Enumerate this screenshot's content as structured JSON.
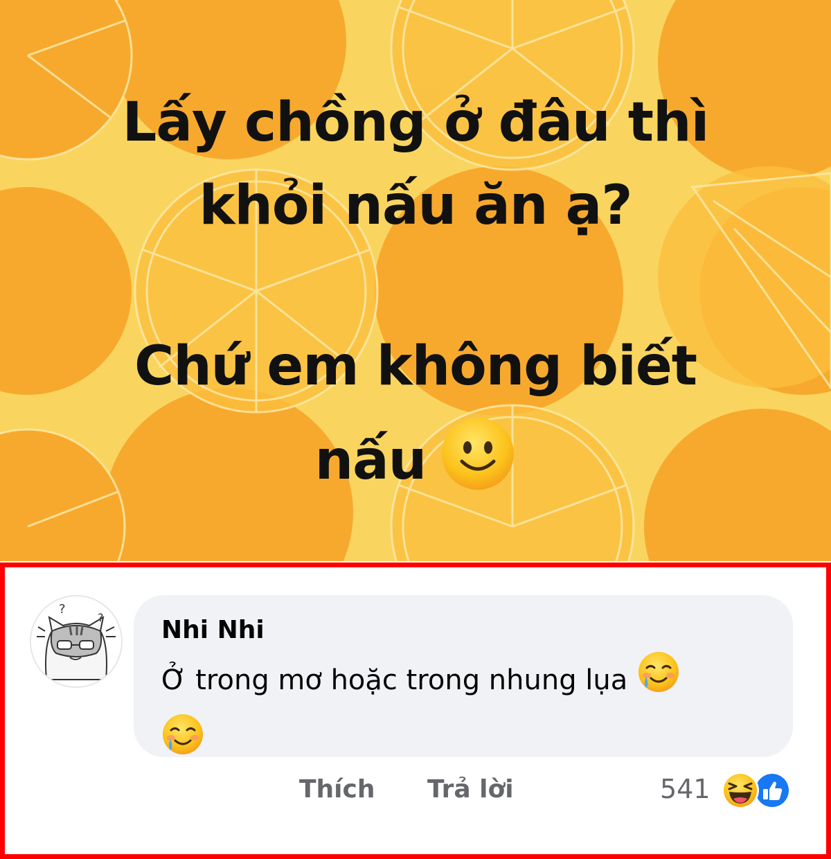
{
  "post": {
    "lines": [
      "Lấy chồng ở đâu thì",
      "khỏi nấu ăn ạ?",
      "Chứ em không biết",
      "nấu"
    ],
    "trailing_emoji": "slightly-smiling-face-icon",
    "background": "orange-slices-pattern",
    "colors": {
      "background": "#f9d55f",
      "orange": "#f7a72b",
      "text": "#111111"
    }
  },
  "comment": {
    "author": "Nhi Nhi",
    "text": "Ở trong mơ hoặc trong nhung lụa",
    "emojis": [
      "smiling-face-with-tear-icon",
      "smiling-face-with-tear-icon"
    ],
    "avatar": "cat-avatar",
    "actions": {
      "like_label": "Thích",
      "reply_label": "Trả lời"
    },
    "reactions": {
      "count": "541",
      "icons": [
        "haha-reaction-icon",
        "like-reaction-icon"
      ]
    }
  },
  "colors": {
    "frame_border": "#ff0000",
    "bubble": "#f0f2f5",
    "secondary_text": "#65676b",
    "like_blue": "#1877f2"
  }
}
